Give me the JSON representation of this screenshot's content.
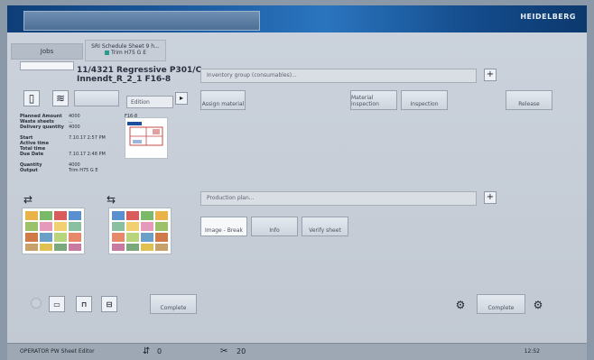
{
  "window": {
    "title": "",
    "brand": "HEIDELBERG"
  },
  "tabs": [
    {
      "label": "Jobs"
    },
    {
      "line1": "SRI Schedule Sheet 9 h...",
      "line2": "Trim H75 G E"
    }
  ],
  "job": {
    "title_line1": "11/4321 Regressive P301/C...",
    "title_line2": "Innendt_R_2_1 F16-8"
  },
  "toolbar": {
    "edit_label": "",
    "dropdown_value": "Edition"
  },
  "right_sections": {
    "top_field": "Inventory group (consumables)...",
    "top_buttons": [
      "Assign material",
      "Material inspection",
      "Inspection",
      "Release"
    ],
    "bottom_field": "Production plan...",
    "bottom_buttons": [
      "Image - Break",
      "Info",
      "Verify sheet"
    ]
  },
  "properties": [
    {
      "key": "Planned Amount",
      "value": "4000"
    },
    {
      "key": "Waste sheets",
      "value": "..."
    },
    {
      "key": "Delivery quantity",
      "value": "4000"
    },
    {
      "key": "Start",
      "value": "7.10.17 2:57 PM"
    },
    {
      "key": "Active time",
      "value": ""
    },
    {
      "key": "Total time",
      "value": ""
    },
    {
      "key": "Due Date",
      "value": "7.10.17 2:48 PM"
    },
    {
      "key": "Quantity",
      "value": "4000"
    },
    {
      "key": "Output",
      "value": "Trim H75 G E"
    }
  ],
  "thumb_small_label": "F16-8",
  "bottom_toolbar": {
    "buttons": [
      "▭",
      "⊓",
      "⊟"
    ],
    "action_label": "Complete",
    "right_action_label": "Complete"
  },
  "status_bar": {
    "left_text": "OPERATOR PW Sheet Editor",
    "indicator1_value": "0",
    "indicator2_value": "20",
    "right_text": "12:52"
  },
  "colors": {
    "titlebar": "#1e5fa5",
    "panel": "#c7ced8",
    "status_bar": "#9ea8b5"
  }
}
